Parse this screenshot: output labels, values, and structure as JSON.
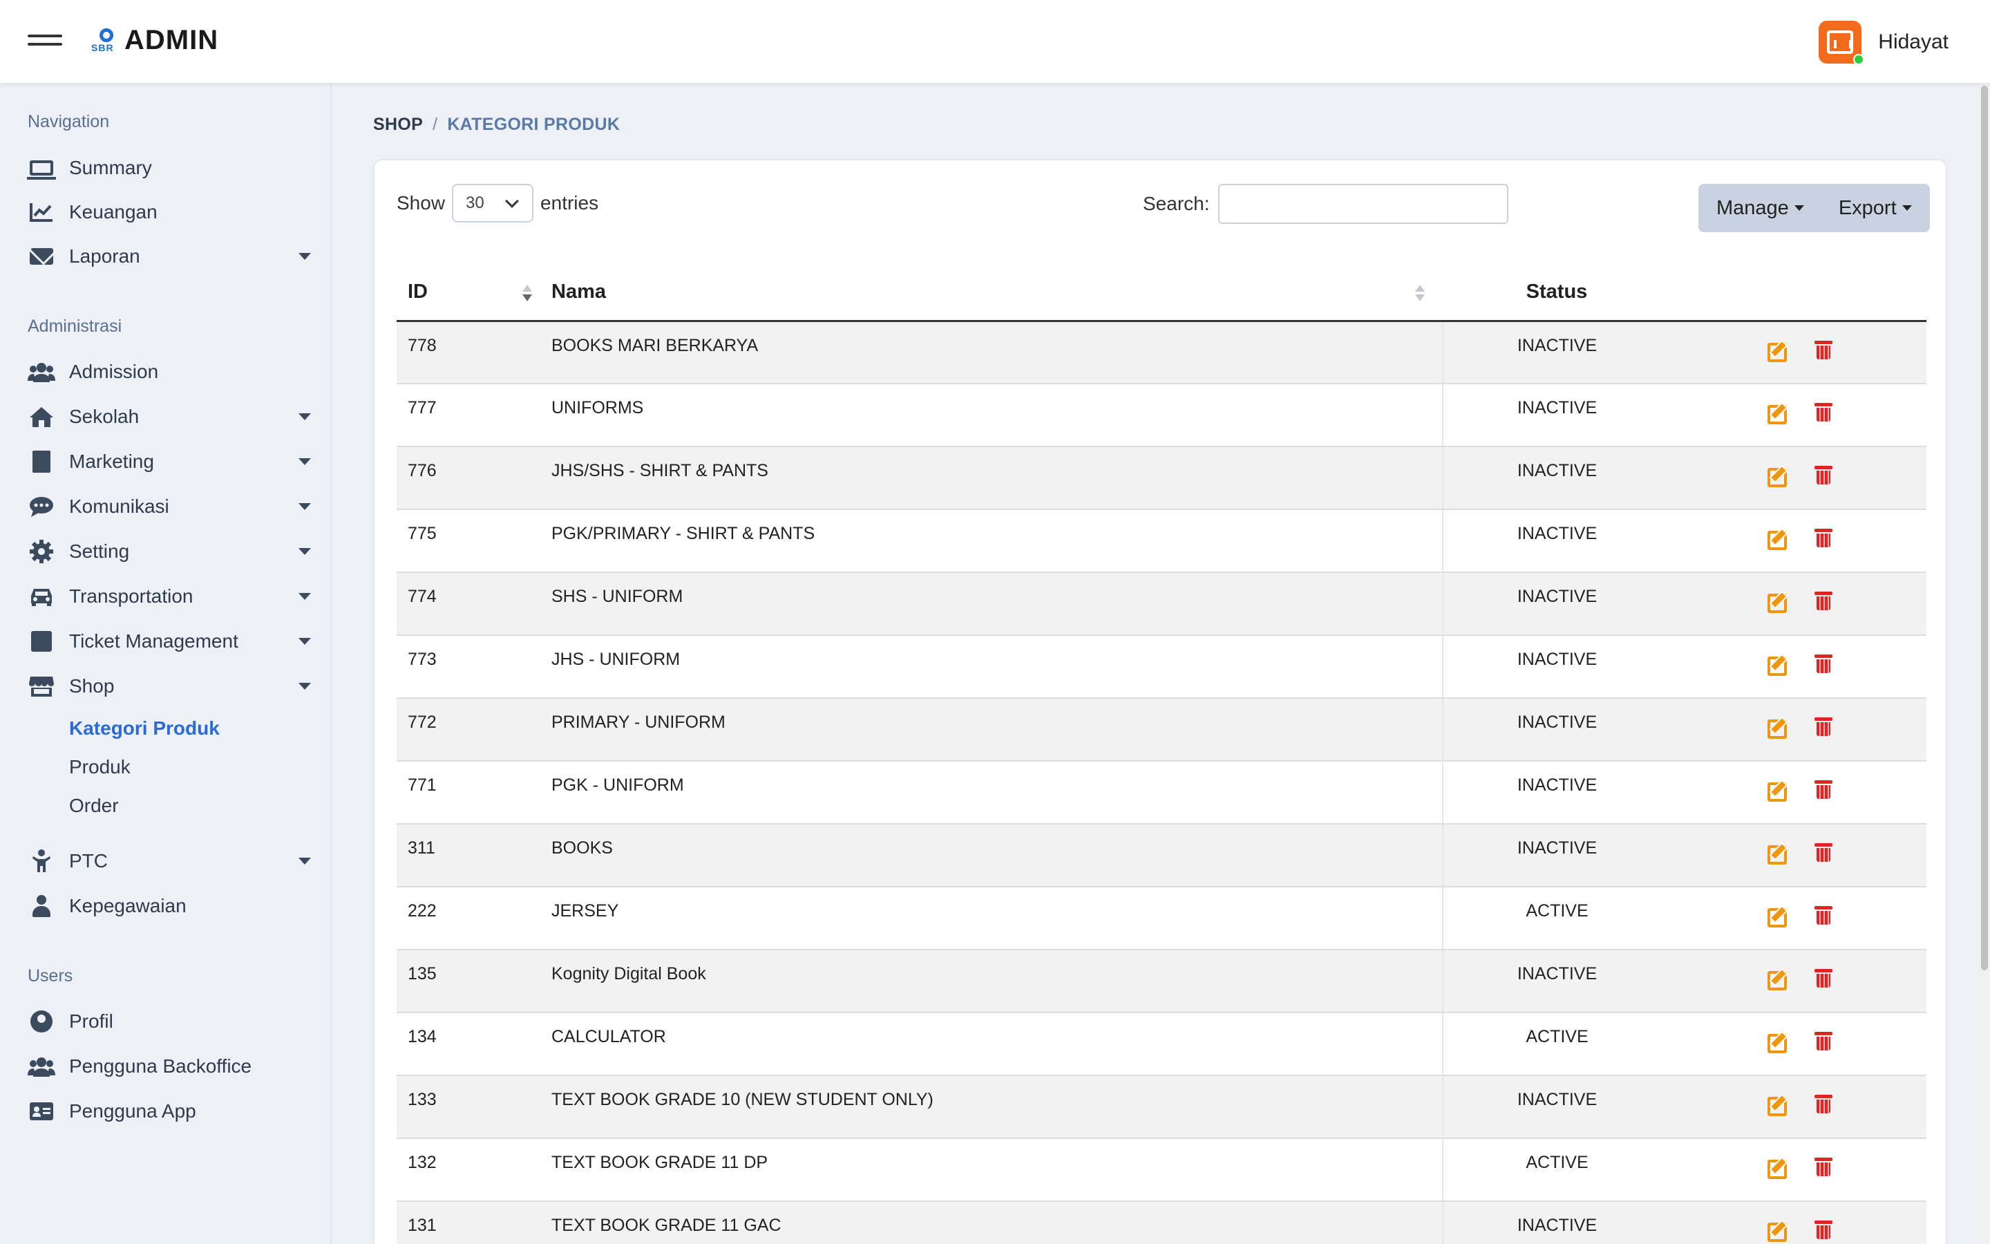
{
  "header": {
    "logo_mark": "SBR",
    "logo_text": "ADMIN",
    "user_name": "Hidayat"
  },
  "sidebar": {
    "sections": [
      {
        "heading": "Navigation"
      },
      {
        "heading": "Administrasi"
      },
      {
        "heading": "Users"
      }
    ],
    "items": [
      {
        "label": "Summary",
        "icon": "laptop-icon"
      },
      {
        "label": "Keuangan",
        "icon": "chart-line-icon"
      },
      {
        "label": "Laporan",
        "icon": "envelope-icon"
      },
      {
        "label": "Admission",
        "icon": "users-icon"
      },
      {
        "label": "Sekolah",
        "icon": "home-icon"
      },
      {
        "label": "Marketing",
        "icon": "file-icon"
      },
      {
        "label": "Komunikasi",
        "icon": "comment-icon"
      },
      {
        "label": "Setting",
        "icon": "gear-icon"
      },
      {
        "label": "Transportation",
        "icon": "car-icon"
      },
      {
        "label": "Ticket Management",
        "icon": "calendar-icon"
      },
      {
        "label": "Shop",
        "icon": "store-icon"
      },
      {
        "label": "PTC",
        "icon": "child-icon"
      },
      {
        "label": "Kepegawaian",
        "icon": "user-tie-icon"
      },
      {
        "label": "Profil",
        "icon": "user-circle-icon"
      },
      {
        "label": "Pengguna Backoffice",
        "icon": "users-icon"
      },
      {
        "label": "Pengguna App",
        "icon": "id-card-icon"
      }
    ],
    "shop_sub": [
      {
        "label": "Kategori Produk"
      },
      {
        "label": "Produk"
      },
      {
        "label": "Order"
      }
    ]
  },
  "breadcrumb": {
    "root": "SHOP",
    "separator": "/",
    "current": "KATEGORI PRODUK"
  },
  "controls": {
    "show_label": "Show",
    "entries_value": "30",
    "entries_label": "entries",
    "search_label": "Search:",
    "search_value": "",
    "manage_label": "Manage",
    "export_label": "Export"
  },
  "table": {
    "headers": {
      "id": "ID",
      "nama": "Nama",
      "status": "Status"
    },
    "rows": [
      {
        "id": "778",
        "nama": "BOOKS MARI BERKARYA",
        "status": "INACTIVE"
      },
      {
        "id": "777",
        "nama": "UNIFORMS",
        "status": "INACTIVE"
      },
      {
        "id": "776",
        "nama": "JHS/SHS - SHIRT & PANTS",
        "status": "INACTIVE"
      },
      {
        "id": "775",
        "nama": "PGK/PRIMARY - SHIRT & PANTS",
        "status": "INACTIVE"
      },
      {
        "id": "774",
        "nama": "SHS - UNIFORM",
        "status": "INACTIVE"
      },
      {
        "id": "773",
        "nama": "JHS - UNIFORM",
        "status": "INACTIVE"
      },
      {
        "id": "772",
        "nama": "PRIMARY - UNIFORM",
        "status": "INACTIVE"
      },
      {
        "id": "771",
        "nama": "PGK - UNIFORM",
        "status": "INACTIVE"
      },
      {
        "id": "311",
        "nama": "BOOKS",
        "status": "INACTIVE"
      },
      {
        "id": "222",
        "nama": "JERSEY",
        "status": "ACTIVE"
      },
      {
        "id": "135",
        "nama": "Kognity Digital Book",
        "status": "INACTIVE"
      },
      {
        "id": "134",
        "nama": "CALCULATOR",
        "status": "ACTIVE"
      },
      {
        "id": "133",
        "nama": "TEXT BOOK GRADE 10 (NEW STUDENT ONLY)",
        "status": "INACTIVE"
      },
      {
        "id": "132",
        "nama": "TEXT BOOK GRADE 11 DP",
        "status": "ACTIVE"
      },
      {
        "id": "131",
        "nama": "TEXT BOOK GRADE 11 GAC",
        "status": "INACTIVE"
      }
    ]
  },
  "colors": {
    "accent": "#2b6bd6",
    "edit": "#f0960e",
    "delete": "#e02424",
    "avatar": "#f26a1b"
  }
}
